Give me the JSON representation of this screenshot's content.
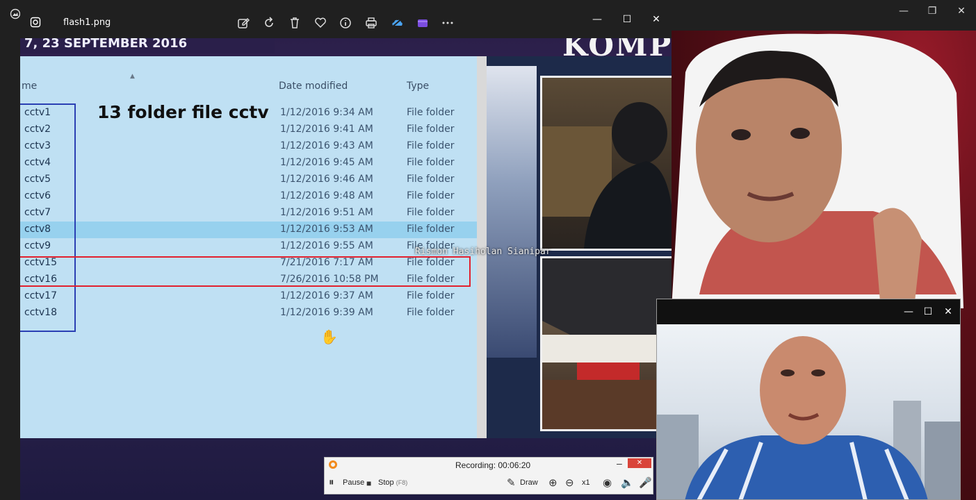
{
  "viewer": {
    "filename": "flash1.png",
    "toolbar_icons": [
      "edit-icon",
      "rotate-icon",
      "delete-icon",
      "favorite-icon",
      "info-icon",
      "print-icon",
      "onedrive-icon",
      "clipchamp-icon",
      "more-icon"
    ]
  },
  "image": {
    "banner_fragment": "7, 23 SEPTEMBER 2016",
    "brand_fragment": "KOMP",
    "annotation": "13 folder file cctv",
    "caption": "Rismon Hasiholan Sianipar",
    "explorer": {
      "headers": {
        "name": "me",
        "date": "Date modified",
        "type": "Type"
      },
      "rows": [
        {
          "name": "cctv1",
          "date": "1/12/2016 9:34 AM",
          "type": "File folder"
        },
        {
          "name": "cctv2",
          "date": "1/12/2016 9:41 AM",
          "type": "File folder"
        },
        {
          "name": "cctv3",
          "date": "1/12/2016 9:43 AM",
          "type": "File folder"
        },
        {
          "name": "cctv4",
          "date": "1/12/2016 9:45 AM",
          "type": "File folder"
        },
        {
          "name": "cctv5",
          "date": "1/12/2016 9:46 AM",
          "type": "File folder"
        },
        {
          "name": "cctv6",
          "date": "1/12/2016 9:48 AM",
          "type": "File folder"
        },
        {
          "name": "cctv7",
          "date": "1/12/2016 9:51 AM",
          "type": "File folder"
        },
        {
          "name": "cctv8",
          "date": "1/12/2016 9:53 AM",
          "type": "File folder"
        },
        {
          "name": "cctv9",
          "date": "1/12/2016 9:55 AM",
          "type": "File folder"
        },
        {
          "name": "cctv15",
          "date": "7/21/2016 7:17 AM",
          "type": "File folder"
        },
        {
          "name": "cctv16",
          "date": "7/26/2016 10:58 PM",
          "type": "File folder"
        },
        {
          "name": "cctv17",
          "date": "1/12/2016 9:37 AM",
          "type": "File folder"
        },
        {
          "name": "cctv18",
          "date": "1/12/2016 9:39 AM",
          "type": "File folder"
        }
      ]
    }
  },
  "recorder": {
    "status": "Recording:  00:06:20",
    "pause": "Pause",
    "stop": "Stop",
    "stop_key": "(F8)",
    "draw": "Draw",
    "zoom": "x1"
  },
  "colors": {
    "highlight_blue": "#2a3fb3",
    "highlight_red": "#e2212e",
    "selected_row": "#97d1ee",
    "recorder_accent": "#f28b1e"
  }
}
